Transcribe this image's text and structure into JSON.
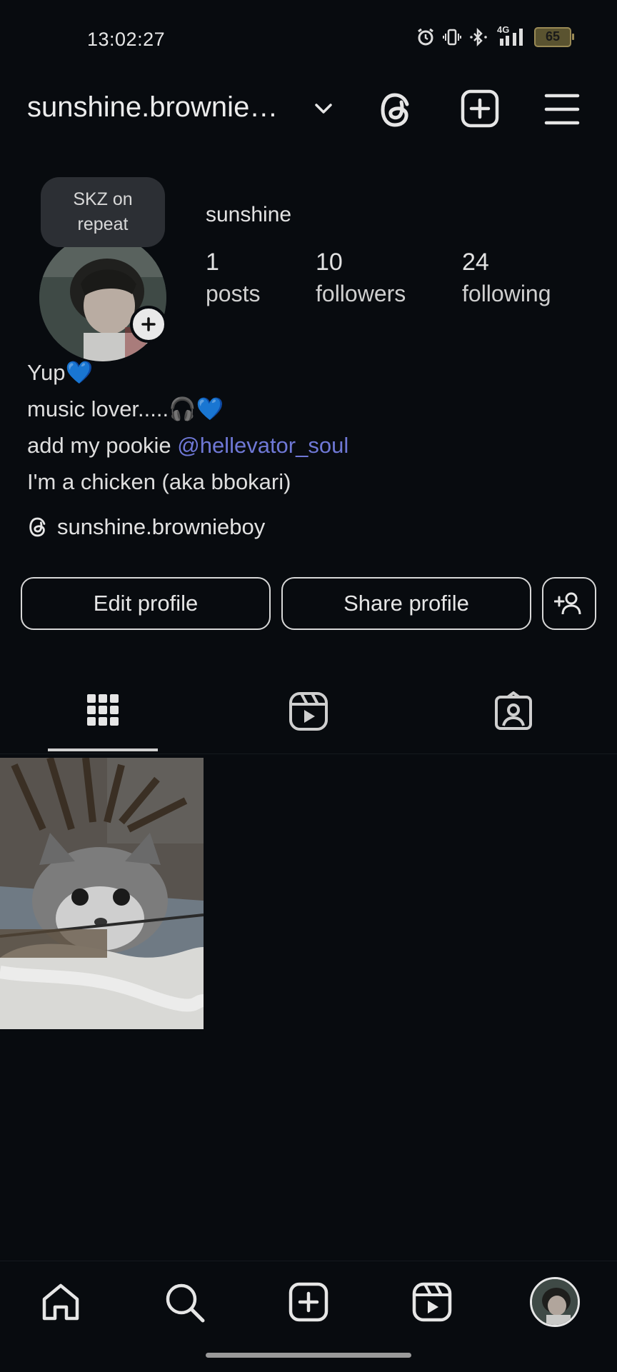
{
  "status_bar": {
    "time": "13:02:27",
    "network": "4G",
    "battery": "65"
  },
  "header": {
    "username": "sunshine.brownie…",
    "icons": [
      "chevron-down-icon",
      "threads-icon",
      "create-post-icon",
      "menu-icon"
    ]
  },
  "profile": {
    "note": "SKZ on repeat",
    "display_name": "sunshine",
    "stats": {
      "posts_count": "1",
      "posts_label": "posts",
      "followers_count": "10",
      "followers_label": "followers",
      "following_count": "24",
      "following_label": "following"
    },
    "bio": {
      "line1": "Yup💙",
      "line2": "music lover.....🎧💙",
      "line3_prefix": "add my pookie ",
      "line3_mention": "@hellevator_soul",
      "line4": "I'm a chicken (aka bbokari)"
    },
    "threads_handle": "sunshine.brownieboy"
  },
  "actions": {
    "edit_profile": "Edit profile",
    "share_profile": "Share profile"
  },
  "tabs": [
    "grid-icon",
    "reels-icon",
    "tagged-icon"
  ],
  "bottom_nav": [
    "home-icon",
    "search-icon",
    "create-icon",
    "reels-icon",
    "profile-avatar"
  ],
  "colors": {
    "background": "#080b0f",
    "mention": "#6f78d6",
    "text": "#e8e8e8"
  }
}
